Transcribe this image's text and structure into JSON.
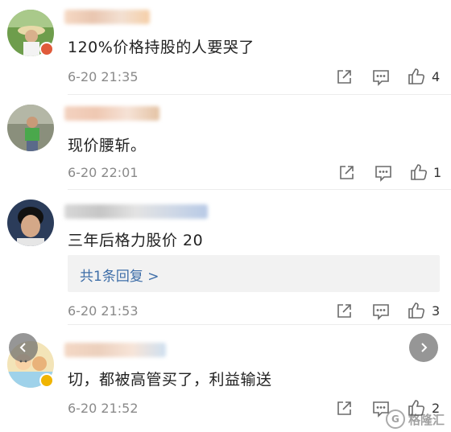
{
  "comments": [
    {
      "text": "120%价格持股的人要哭了",
      "time": "6-20 21:35",
      "likes": "4",
      "badge_color": "#e05a3a"
    },
    {
      "text": "现价腰斩。",
      "time": "6-20 22:01",
      "likes": "1"
    },
    {
      "text": "三年后格力股价 20",
      "time": "6-20 21:53",
      "likes": "3",
      "reply": "共1条回复 >"
    },
    {
      "text": "切，都被高管买了，利益输送",
      "time": "6-20 21:52",
      "likes": "2",
      "badge_color": "#f0b400"
    }
  ],
  "watermark": {
    "logo": "G",
    "text": "格隆汇"
  },
  "icons": {
    "share": "share-icon",
    "comment": "comment-icon",
    "like": "thumbs-up-icon",
    "prev": "chevron-left-icon",
    "next": "chevron-right-icon"
  }
}
